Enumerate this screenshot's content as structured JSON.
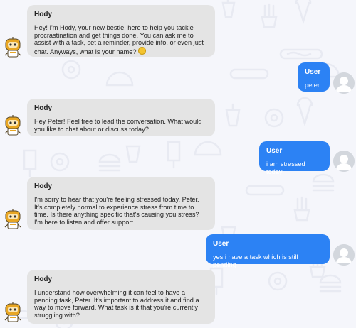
{
  "colors": {
    "background": "#f5f6fb",
    "bot_bubble": "#e4e4e4",
    "user_bubble": "#2c82f4",
    "pattern": "#e8eaf2"
  },
  "messages": [
    {
      "sender": "Hody",
      "text": "Hey! I'm Hody, your new bestie, here to help you tackle procrastination and get things done. You can ask me to assist with a task, set a reminder, provide info, or even just chat. Anyways, what is your name?",
      "emoji_icon": "smiley-emoji-icon"
    },
    {
      "sender": "User",
      "text": "peter"
    },
    {
      "sender": "Hody",
      "text": "Hey Peter! Feel free to lead the conversation. What would you like to chat about or discuss today?"
    },
    {
      "sender": "User",
      "text": "i am stressed today"
    },
    {
      "sender": "Hody",
      "text": "I'm sorry to hear that you're feeling stressed today, Peter. It's completely normal to experience stress from time to time. Is there anything specific that's causing you stress? I'm here to listen and offer support."
    },
    {
      "sender": "User",
      "text": "yes i have a task which is still pending"
    },
    {
      "sender": "Hody",
      "text": "I understand how overwhelming it can feel to have a pending task, Peter. It's important to address it and find a way to move forward. What task is it that you're currently struggling with?"
    }
  ]
}
